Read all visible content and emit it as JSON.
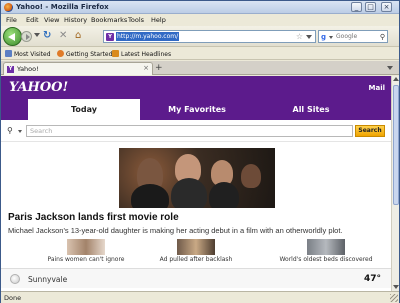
{
  "window": {
    "title": "Yahoo! - Mozilla Firefox",
    "controls": [
      "_",
      "□",
      "×"
    ]
  },
  "menu": [
    "File",
    "Edit",
    "View",
    "History",
    "Bookmarks",
    "Tools",
    "Help"
  ],
  "navbar": {
    "url": "http://m.yahoo.com/",
    "search_placeholder": "Google",
    "search_engine_letter": "g"
  },
  "bookmarks": [
    {
      "label": "Most Visited",
      "color": "#5b7fc4"
    },
    {
      "label": "Getting Started",
      "color": "#e07b28"
    },
    {
      "label": "Latest Headlines",
      "color": "#d98a1c"
    }
  ],
  "tab": {
    "label": "Yahoo!",
    "favicon_letter": "Y"
  },
  "yahoo": {
    "logo": "YAHOO!",
    "mail": "Mail",
    "tabs": [
      "Today",
      "My Favorites",
      "All Sites"
    ],
    "search_placeholder": "Search",
    "search_button": "Search"
  },
  "story": {
    "headline": "Paris Jackson lands first movie role",
    "summary": "Michael Jackson's 13-year-old daughter is making her acting debut in a film with an otherworldly plot."
  },
  "thumbnails": [
    {
      "caption": "Pains women can't ignore"
    },
    {
      "caption": "Ad pulled after backlash"
    },
    {
      "caption": "World's oldest beds discovered"
    }
  ],
  "weather": {
    "city": "Sunnyvale",
    "temp": "47°"
  },
  "status": "Done",
  "colors": {
    "yahoo_purple": "#5c1b8c",
    "search_button": "#ffc21a",
    "url_highlight": "#316ac5"
  }
}
